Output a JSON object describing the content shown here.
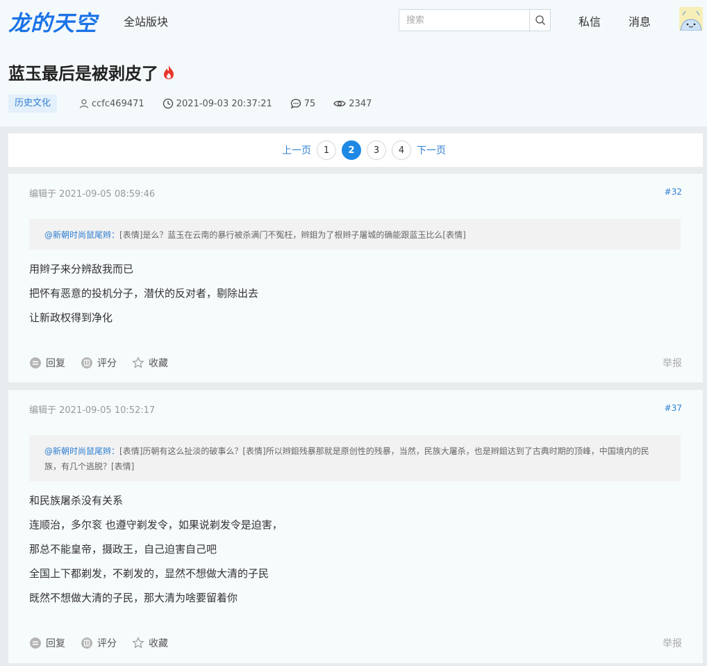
{
  "header": {
    "logo": "龙的天空",
    "nav_all": "全站版块",
    "search_placeholder": "搜索",
    "nav_pm": "私信",
    "nav_msg": "消息"
  },
  "thread": {
    "title": "蓝玉最后是被剥皮了",
    "category": "历史文化",
    "author": "ccfc469471",
    "datetime": "2021-09-03 20:37:21",
    "replies": "75",
    "views": "2347"
  },
  "pager": {
    "prev": "上一页",
    "next": "下一页",
    "pages": [
      "1",
      "2",
      "3",
      "4"
    ],
    "current": "2"
  },
  "posts": [
    {
      "edited": "编辑于 2021-09-05 08:59:46",
      "floor": "#32",
      "quote_user": "@新朝时尚鼠尾辫：",
      "quote_text": "[表情]是么？蓝玉在云南的暴行被杀满门不冤枉，辫鉬为了根辫子屠城的确能跟蓝玉比么[表情]",
      "lines": [
        "用辫子来分辨敌我而已",
        "把怀有恶意的投机分子，潜伏的反对者，剔除出去",
        "让新政权得到净化"
      ],
      "reply": "回复",
      "rate": "评分",
      "favorite": "收藏",
      "report": "举报"
    },
    {
      "edited": "编辑于 2021-09-05 10:52:17",
      "floor": "#37",
      "quote_user": "@新朝时尚鼠尾辫：",
      "quote_text": "[表情]历朝有这么扯淡的破事么？[表情]所以辫鉬残暴那就是原创性的残暴，当然，民族大屠杀，也是辫鉬达到了古典时期的顶峰，中国境内的民族，有几个逃脱？[表情]",
      "lines": [
        "和民族屠杀没有关系",
        "连顺治，多尔衮 也遵守剃发令，如果说剃发令是迫害，",
        "那总不能皇帝，摄政王，自己迫害自己吧",
        "全国上下都剃发，不剃发的，显然不想做大清的子民",
        "既然不想做大清的子民，那大清为啥要留着你"
      ],
      "reply": "回复",
      "rate": "评分",
      "favorite": "收藏",
      "report": "举报"
    }
  ]
}
